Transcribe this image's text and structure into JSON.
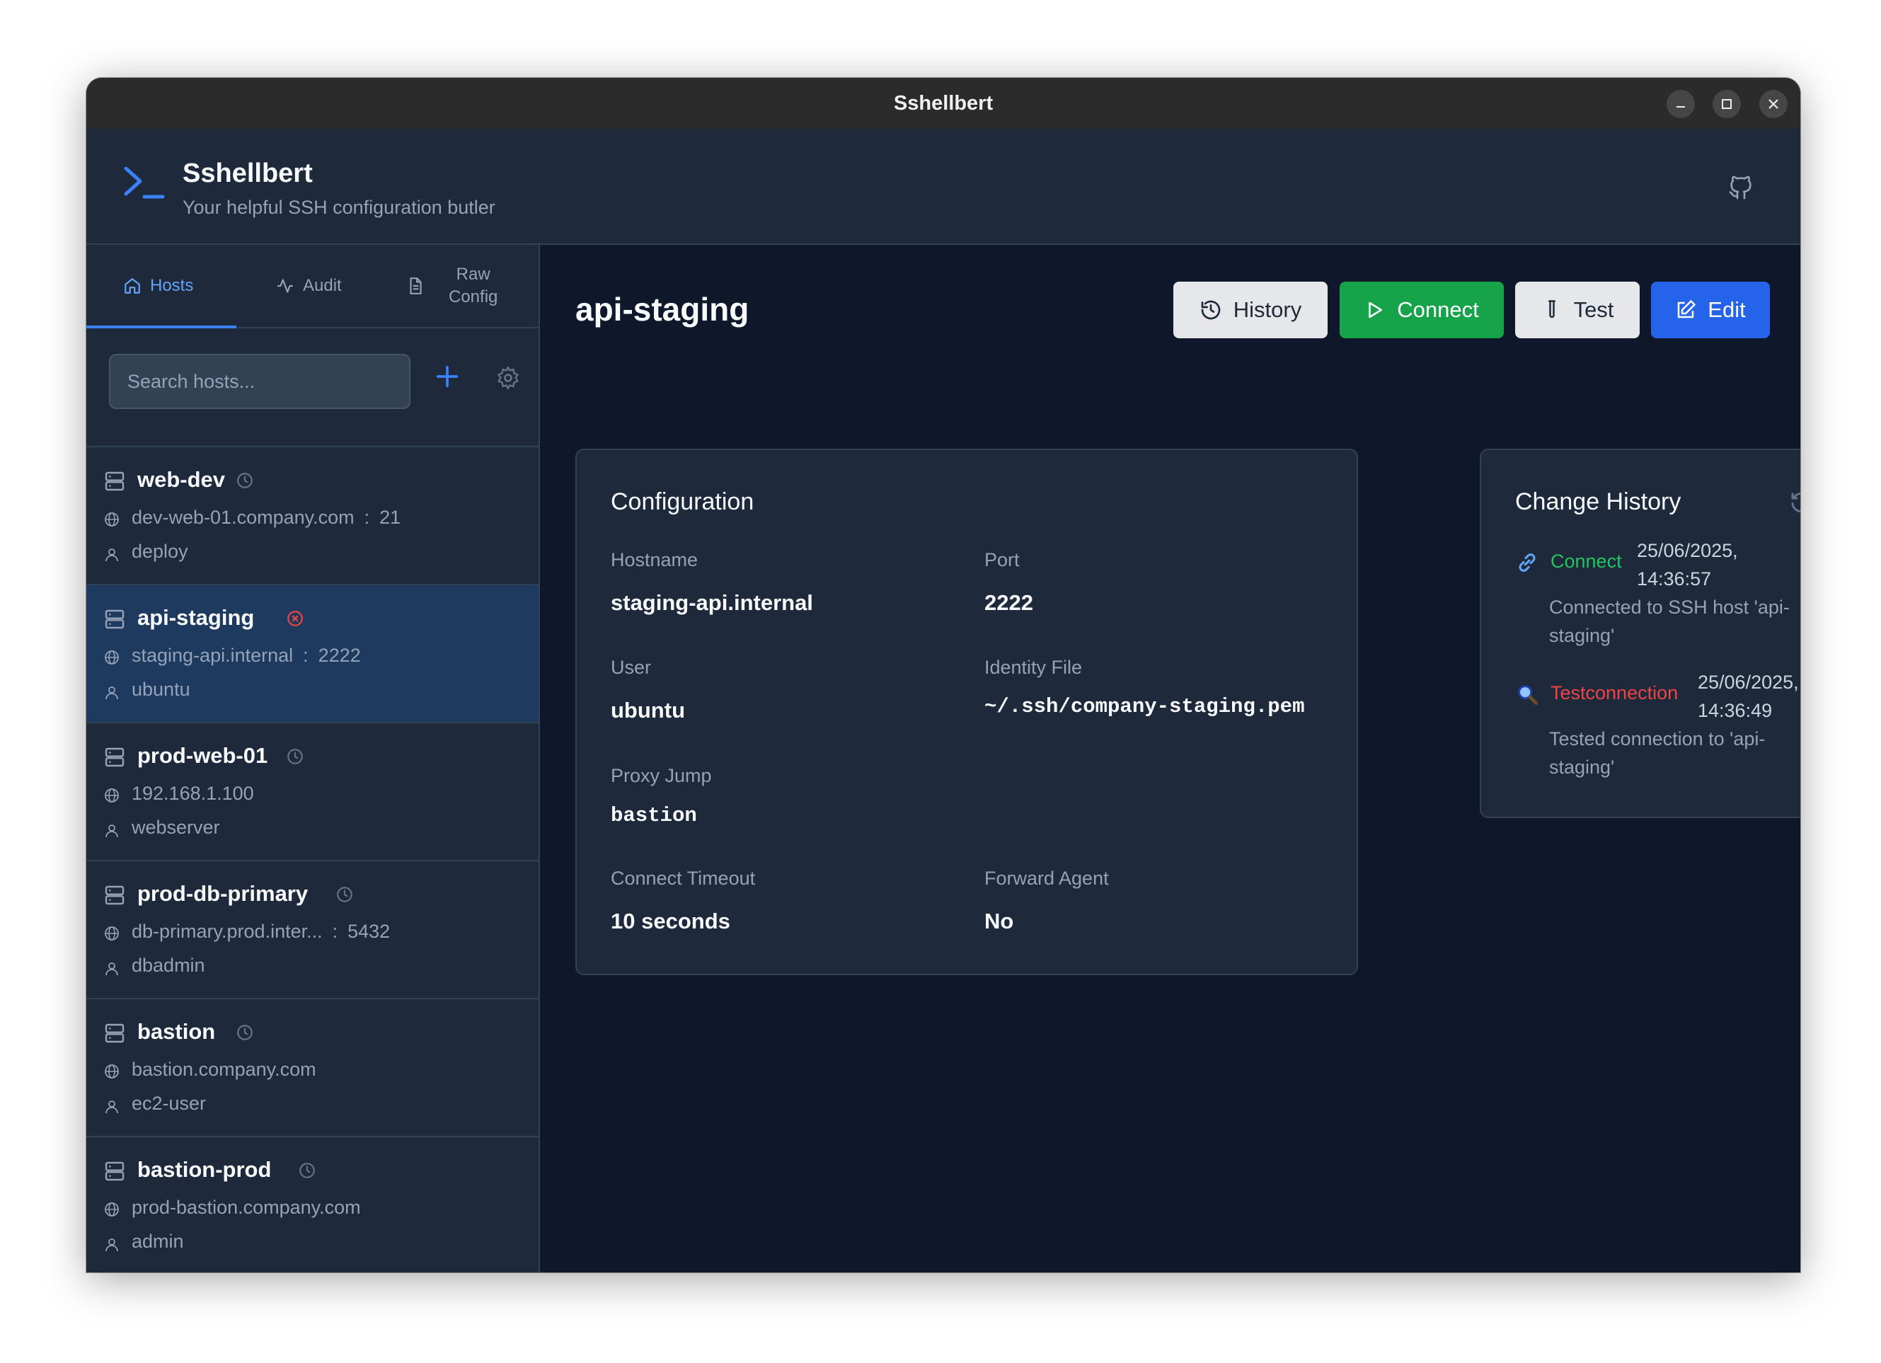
{
  "window": {
    "title": "Sshellbert"
  },
  "header": {
    "title": "Sshellbert",
    "subtitle": "Your helpful SSH configuration butler"
  },
  "tabs": [
    {
      "label": "Hosts"
    },
    {
      "label": "Audit"
    },
    {
      "label_line1": "Raw",
      "label_line2": "Config"
    }
  ],
  "search": {
    "placeholder": "Search hosts..."
  },
  "hosts": [
    {
      "name": "web-dev",
      "hostname": "dev-web-01.company.com",
      "port": "21",
      "user": "deploy",
      "status": "clock"
    },
    {
      "name": "api-staging",
      "hostname": "staging-api.internal",
      "port": "2222",
      "user": "ubuntu",
      "status": "error"
    },
    {
      "name": "prod-web-01",
      "hostname": "192.168.1.100",
      "port": "",
      "user": "webserver",
      "status": "clock"
    },
    {
      "name": "prod-db-primary",
      "hostname": "db-primary.prod.inter...",
      "port": "5432",
      "user": "dbadmin",
      "status": "clock"
    },
    {
      "name": "bastion",
      "hostname": "bastion.company.com",
      "port": "",
      "user": "ec2-user",
      "status": "clock"
    },
    {
      "name": "bastion-prod",
      "hostname": "prod-bastion.company.com",
      "port": "",
      "user": "admin",
      "status": "clock"
    }
  ],
  "selected_host": {
    "title": "api-staging",
    "actions": {
      "history": "History",
      "connect": "Connect",
      "test": "Test",
      "edit": "Edit"
    }
  },
  "configuration": {
    "title": "Configuration",
    "hostname_label": "Hostname",
    "hostname": "staging-api.internal",
    "port_label": "Port",
    "port": "2222",
    "user_label": "User",
    "user": "ubuntu",
    "identity_label": "Identity File",
    "identity": "~/.ssh/company-staging.pem",
    "proxy_label": "Proxy Jump",
    "proxy": "bastion",
    "timeout_label": "Connect Timeout",
    "timeout": "10 seconds",
    "forward_label": "Forward Agent",
    "forward": "No"
  },
  "change_history": {
    "title": "Change History",
    "entries": [
      {
        "type": "Connect",
        "date": "25/06/2025,",
        "time": "14:36:57",
        "desc_line1": "Connected to SSH host 'api-",
        "desc_line2": "staging'",
        "color": "#22c55e"
      },
      {
        "type": "Testconnection",
        "date": "25/06/2025,",
        "time": "14:36:49",
        "desc_line1": "Tested connection to 'api-",
        "desc_line2": "staging'",
        "color": "#ef4444"
      }
    ]
  },
  "colors": {
    "accent": "#3b82f6",
    "success": "#16a34a",
    "danger": "#ef4444"
  }
}
